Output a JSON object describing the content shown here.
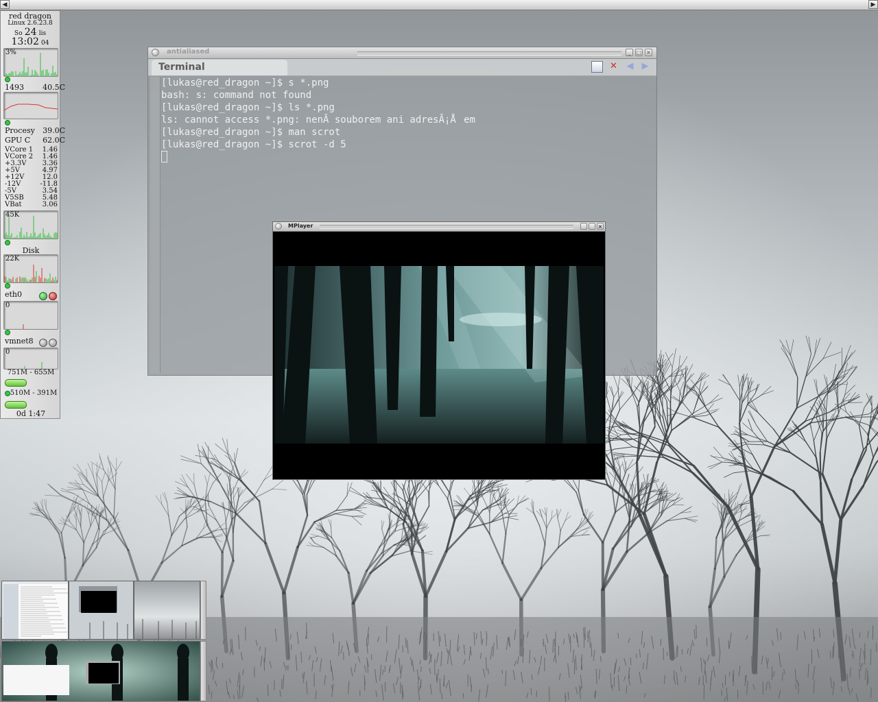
{
  "gkrellm": {
    "hostname": "red dragon",
    "kernel": "Linux 2.6.23.8",
    "day": "So",
    "date": "24",
    "month": "lis",
    "time": "13:02",
    "seconds": "04",
    "cpu_percent": "3%",
    "fan_rpm": "1493",
    "fan_temp": "40.5C",
    "processor_label": "Procesy",
    "processor_temp": "39.0C",
    "gpu_label": "GPU C",
    "gpu_temp": "62.0C",
    "voltages": [
      {
        "name": "VCore 1",
        "value": "1.46"
      },
      {
        "name": "VCore 2",
        "value": "1.46"
      },
      {
        "name": "+3.3V",
        "value": "3.36"
      },
      {
        "name": "+5V",
        "value": "4.97"
      },
      {
        "name": "+12V",
        "value": "12.0"
      },
      {
        "name": "-12V",
        "value": "-11.8"
      },
      {
        "name": "-5V",
        "value": "3.54"
      },
      {
        "name": "V5SB",
        "value": "5.48"
      },
      {
        "name": "VBat",
        "value": "3.06"
      }
    ],
    "proc_value": "45K",
    "disk_label": "Disk",
    "disk_value": "22K",
    "net1_label": "eth0",
    "net1_value": "0",
    "net2_label": "vmnet8",
    "net2_value": "0",
    "mem": "751M - 655M",
    "swap": "510M - 391M",
    "uptime": "0d 1:47"
  },
  "terminal": {
    "window_title": "antialiased",
    "tab_label": "Terminal",
    "lines": [
      "[lukas@red_dragon ~]$ s *.png",
      "bash: s: command not found",
      "[lukas@red_dragon ~]$ ls *.png",
      "ls: cannot access *.png: nenÃ­ souborem ani adresÃ¡Åem",
      "[lukas@red_dragon ~]$ man scrot",
      "[lukas@red_dragon ~]$ scrot -d 5"
    ],
    "close_icon": "x-icon",
    "colors": {
      "close": "#cc2b2b",
      "nav": "#7a8fd8"
    }
  },
  "mplayer": {
    "window_title": "MPlayer"
  }
}
